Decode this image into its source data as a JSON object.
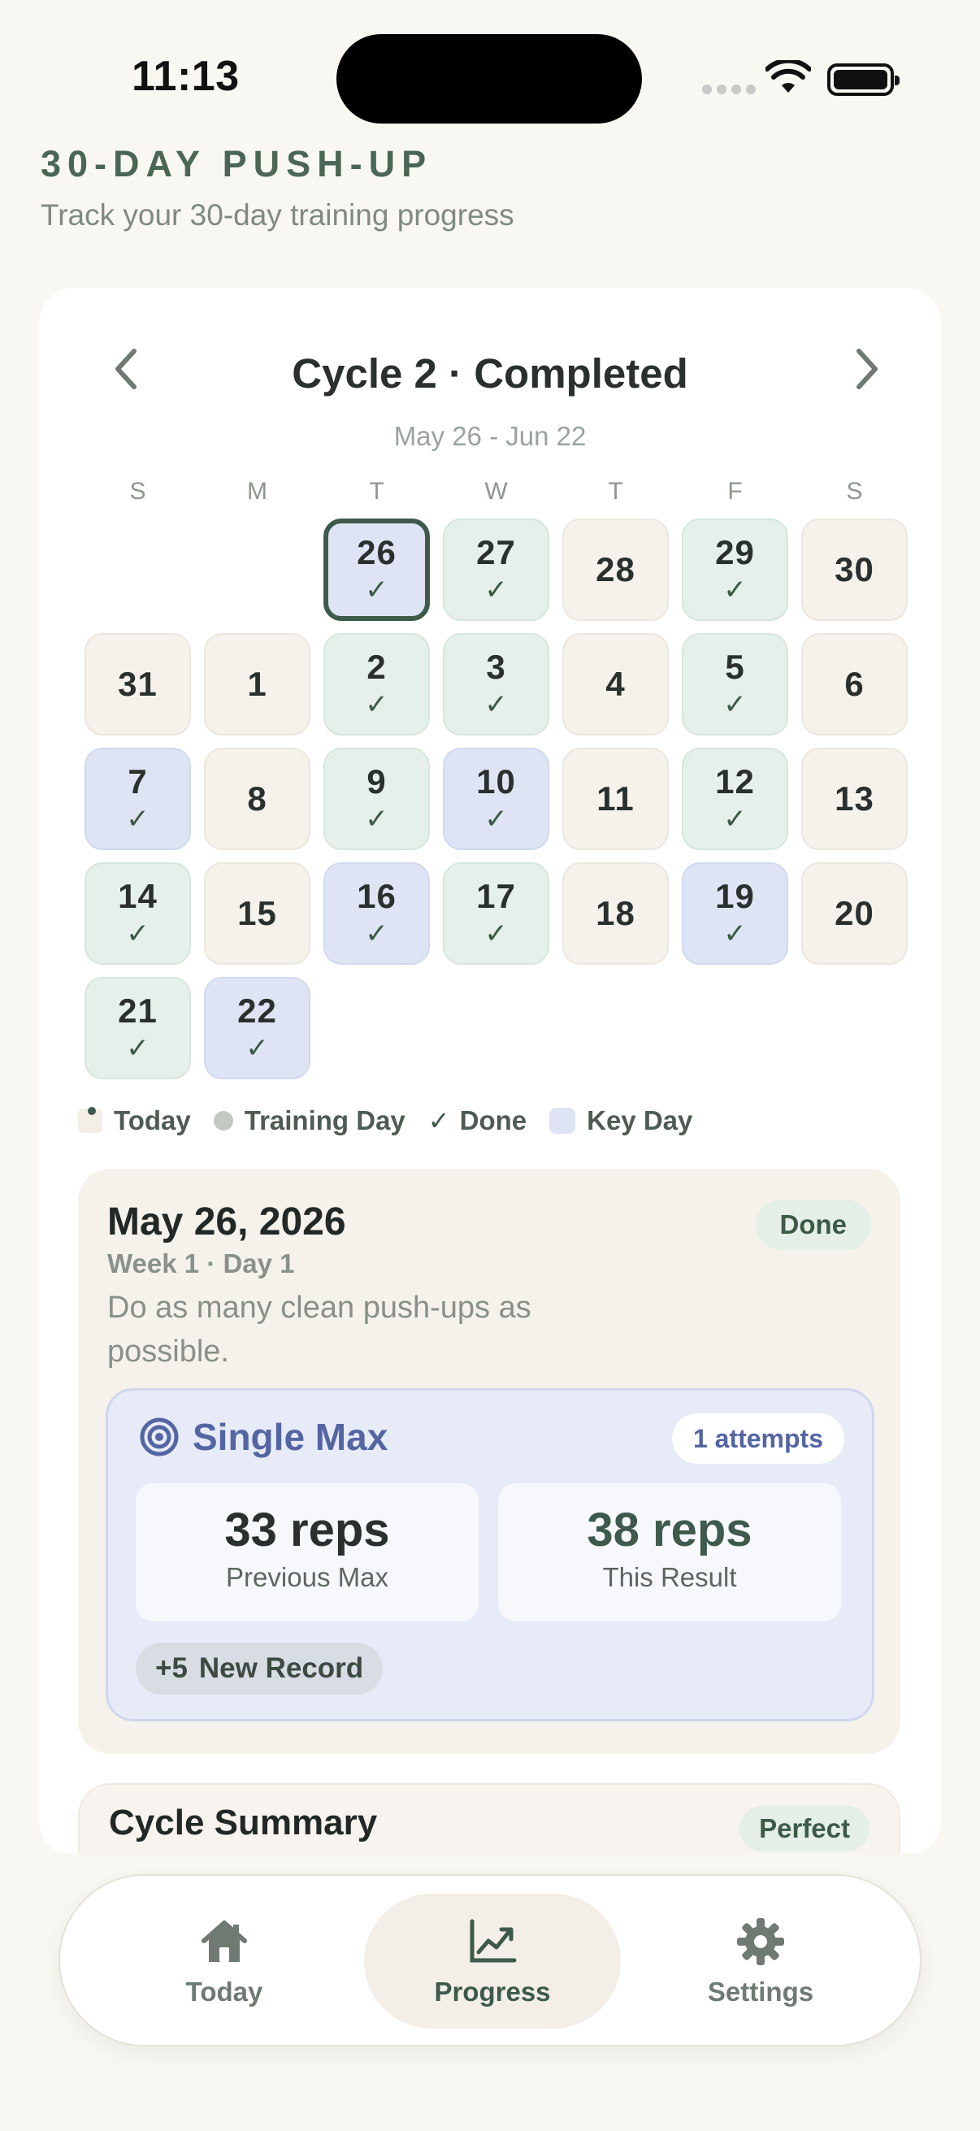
{
  "status_bar": {
    "time": "11:13"
  },
  "header": {
    "title": "30-DAY PUSH-UP",
    "subtitle": "Track your 30-day training progress"
  },
  "calendar": {
    "title": "Cycle 2 · Completed",
    "range": "May 26 - Jun 22",
    "weekdays": [
      "S",
      "M",
      "T",
      "W",
      "T",
      "F",
      "S"
    ],
    "days": [
      {
        "n": "26",
        "state": "key",
        "done": true,
        "today": true
      },
      {
        "n": "27",
        "state": "done",
        "done": true
      },
      {
        "n": "28",
        "state": "rest",
        "done": false
      },
      {
        "n": "29",
        "state": "done",
        "done": true
      },
      {
        "n": "30",
        "state": "rest",
        "done": false
      },
      {
        "n": "31",
        "state": "rest",
        "done": false
      },
      {
        "n": "1",
        "state": "rest",
        "done": false
      },
      {
        "n": "2",
        "state": "done",
        "done": true
      },
      {
        "n": "3",
        "state": "done",
        "done": true
      },
      {
        "n": "4",
        "state": "rest",
        "done": false
      },
      {
        "n": "5",
        "state": "done",
        "done": true
      },
      {
        "n": "6",
        "state": "rest",
        "done": false
      },
      {
        "n": "7",
        "state": "key",
        "done": true
      },
      {
        "n": "8",
        "state": "rest",
        "done": false
      },
      {
        "n": "9",
        "state": "done",
        "done": true
      },
      {
        "n": "10",
        "state": "key",
        "done": true
      },
      {
        "n": "11",
        "state": "rest",
        "done": false
      },
      {
        "n": "12",
        "state": "done",
        "done": true
      },
      {
        "n": "13",
        "state": "rest",
        "done": false
      },
      {
        "n": "14",
        "state": "done",
        "done": true
      },
      {
        "n": "15",
        "state": "rest",
        "done": false
      },
      {
        "n": "16",
        "state": "key",
        "done": true
      },
      {
        "n": "17",
        "state": "done",
        "done": true
      },
      {
        "n": "18",
        "state": "rest",
        "done": false
      },
      {
        "n": "19",
        "state": "key",
        "done": true
      },
      {
        "n": "20",
        "state": "rest",
        "done": false
      },
      {
        "n": "21",
        "state": "done",
        "done": true
      },
      {
        "n": "22",
        "state": "key",
        "done": true
      }
    ],
    "check_glyph": "✓",
    "legend": {
      "today": "Today",
      "training": "Training Day",
      "done": "Done",
      "key": "Key Day"
    }
  },
  "detail": {
    "date": "May 26, 2026",
    "badge": "Done",
    "week_day": "Week 1 · Day 1",
    "description": "Do as many clean push-ups as possible.",
    "record": {
      "title": "Single Max",
      "attempts": "1 attempts",
      "previous_value": "33 reps",
      "previous_label": "Previous Max",
      "result_value": "38 reps",
      "result_label": "This Result",
      "delta": "+5",
      "new_record": "New Record"
    }
  },
  "summary": {
    "title": "Cycle Summary",
    "badge": "Perfect"
  },
  "tabs": {
    "today": "Today",
    "progress": "Progress",
    "settings": "Settings"
  },
  "colors": {
    "accent": "#3d5a4c",
    "done_bg": "#e6f0ea",
    "key_bg": "#dfe4f5",
    "rest_bg": "#f5f2ec"
  }
}
